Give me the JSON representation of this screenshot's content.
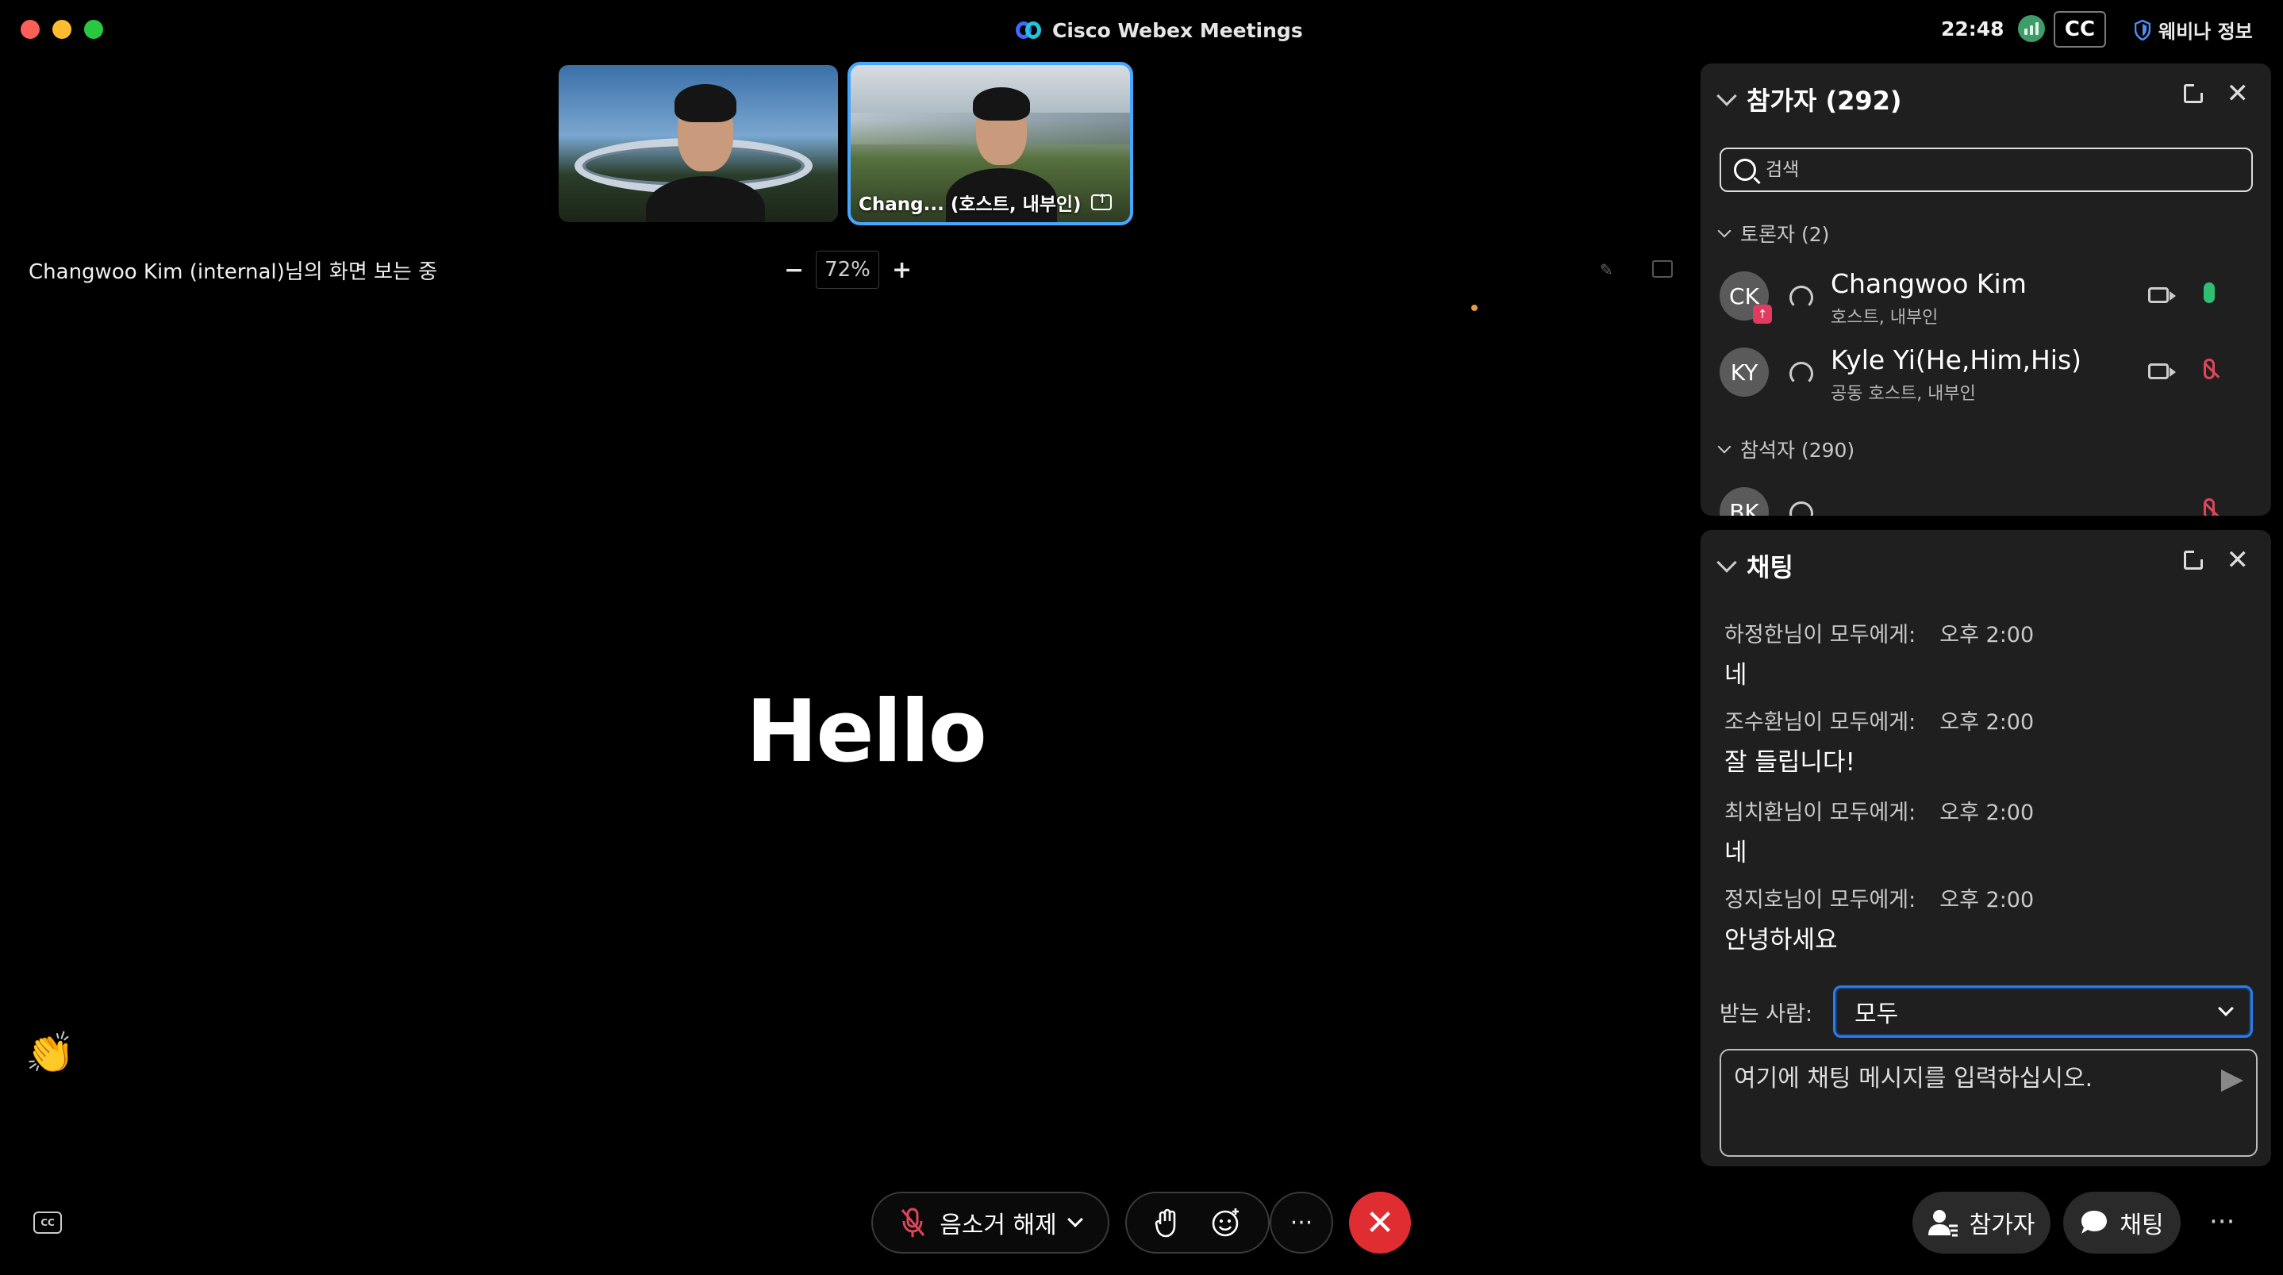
{
  "app": {
    "title": "Cisco Webex Meetings",
    "clock": "22:48",
    "cc_label": "CC",
    "webinar_info": "웨비나 정보"
  },
  "videos": [
    {
      "label": ""
    },
    {
      "label": "Chang... (호스트, 내부인)"
    }
  ],
  "share": {
    "viewing_text": "Changwoo Kim (internal)님의 화면 보는 중",
    "zoom_minus": "−",
    "zoom_value": "72%",
    "zoom_plus": "+",
    "content_text": "Hello"
  },
  "reaction_emoji": "👏",
  "controls": {
    "unmute_label": "음소거 해제",
    "more_label": "···",
    "end_symbol": "✕",
    "participants_button": "참가자",
    "chat_button": "채팅",
    "bottom_more": "···",
    "cc_small": "CC"
  },
  "participants_panel": {
    "title": "참가자 (292)",
    "search_placeholder": "검색",
    "panelists_group": "토론자 (2)",
    "attendees_group": "참석자 (290)",
    "panelists": [
      {
        "initials": "CK",
        "name": "Changwoo Kim",
        "role": "호스트, 내부인",
        "mic": "on"
      },
      {
        "initials": "KY",
        "name": "Kyle Yi(He,Him,His)",
        "role": "공동 호스트, 내부인",
        "mic": "off"
      }
    ],
    "attendees_partial": {
      "initials": "BK"
    }
  },
  "chat_panel": {
    "title": "채팅",
    "messages": [
      {
        "from": "하정한님이 모두에게:",
        "time": "오후 2:00",
        "text": "네"
      },
      {
        "from": "조수환님이 모두에게:",
        "time": "오후 2:00",
        "text": "잘 들립니다!"
      },
      {
        "from": "최치환님이 모두에게:",
        "time": "오후 2:00",
        "text": "네"
      },
      {
        "from": "정지호님이 모두에게:",
        "time": "오후 2:00",
        "text": "안녕하세요"
      }
    ],
    "to_label": "받는 사람:",
    "to_value": "모두",
    "input_placeholder": "여기에 채팅 메시지를 입력하십시오."
  }
}
